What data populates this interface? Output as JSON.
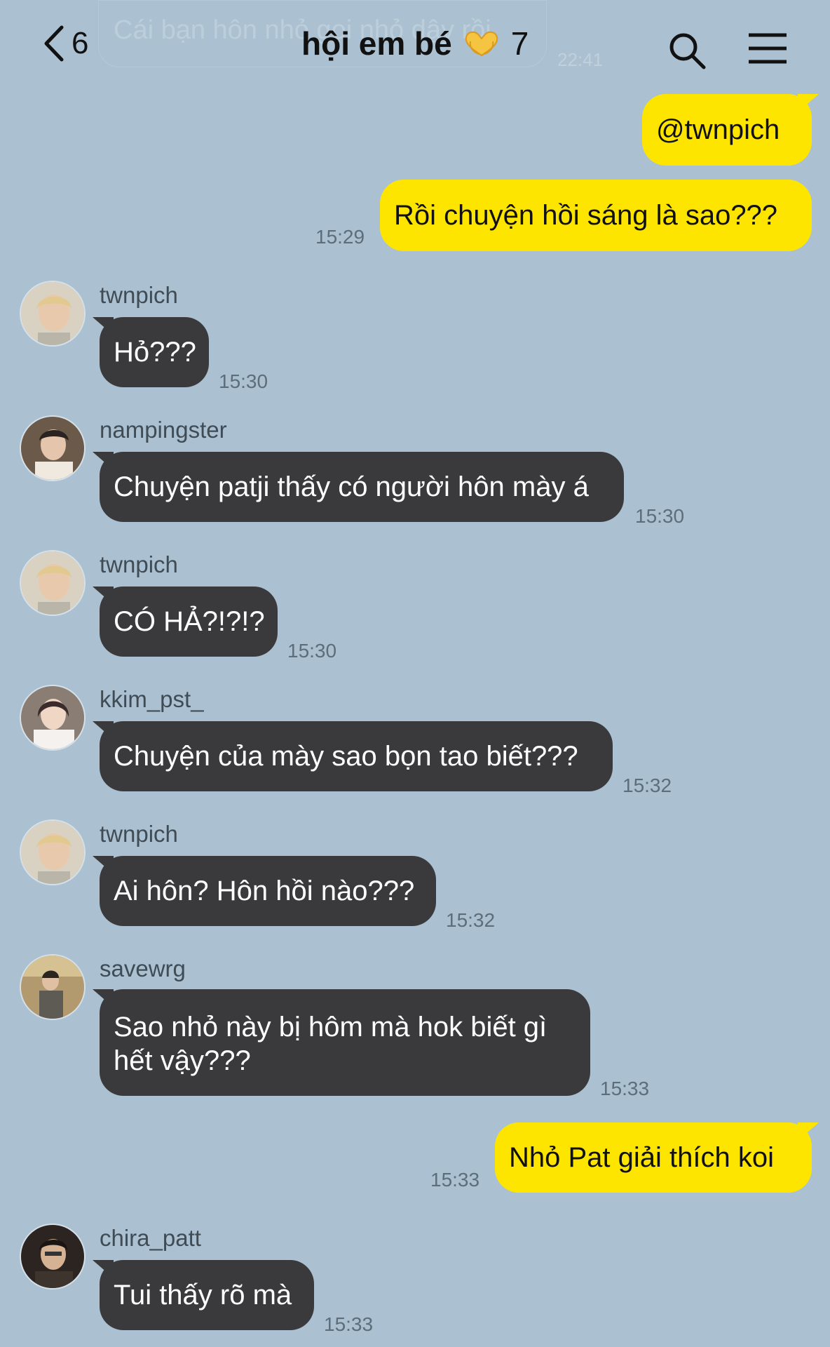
{
  "header": {
    "ghost_text": "Cái bạn hôn nhỏ gọi nhỏ dậy rồi",
    "ghost_time": "22:41",
    "back_count": "6",
    "title": "hội em bé",
    "member_count": "7"
  },
  "messages": [
    {
      "sender": "",
      "text": "@twnpich",
      "time": "",
      "mine": true
    },
    {
      "sender": "",
      "text": "Rồi chuyện hồi sáng là sao???",
      "time": "15:29",
      "mine": true
    },
    {
      "sender": "twnpich",
      "text": "Hỏ???",
      "time": "15:30",
      "mine": false
    },
    {
      "sender": "nampingster",
      "text": "Chuyện patji thấy có người hôn mày á",
      "time": "15:30",
      "mine": false
    },
    {
      "sender": "twnpich",
      "text": "CÓ HẢ?!?!?",
      "time": "15:30",
      "mine": false
    },
    {
      "sender": "kkim_pst_",
      "text": "Chuyện của mày sao bọn tao biết???",
      "time": "15:32",
      "mine": false
    },
    {
      "sender": "twnpich",
      "text": "Ai hôn? Hôn hồi nào???",
      "time": "15:32",
      "mine": false
    },
    {
      "sender": "savewrg",
      "text": "Sao nhỏ này bị hôm mà hok biết gì hết vậy???",
      "time": "15:33",
      "mine": false
    },
    {
      "sender": "",
      "text": "Nhỏ Pat giải thích koi",
      "time": "15:33",
      "mine": true
    },
    {
      "sender": "chira_patt",
      "text": "Tui thấy rõ mà",
      "time": "15:33",
      "mine": false
    }
  ],
  "colors": {
    "background": "#abc1d1",
    "my_bubble": "#fee500",
    "their_bubble": "#3a3a3c"
  },
  "icons": {
    "back": "chevron-left-icon",
    "title_emoji": "heart-hands-icon",
    "search": "search-icon",
    "menu": "menu-icon"
  }
}
